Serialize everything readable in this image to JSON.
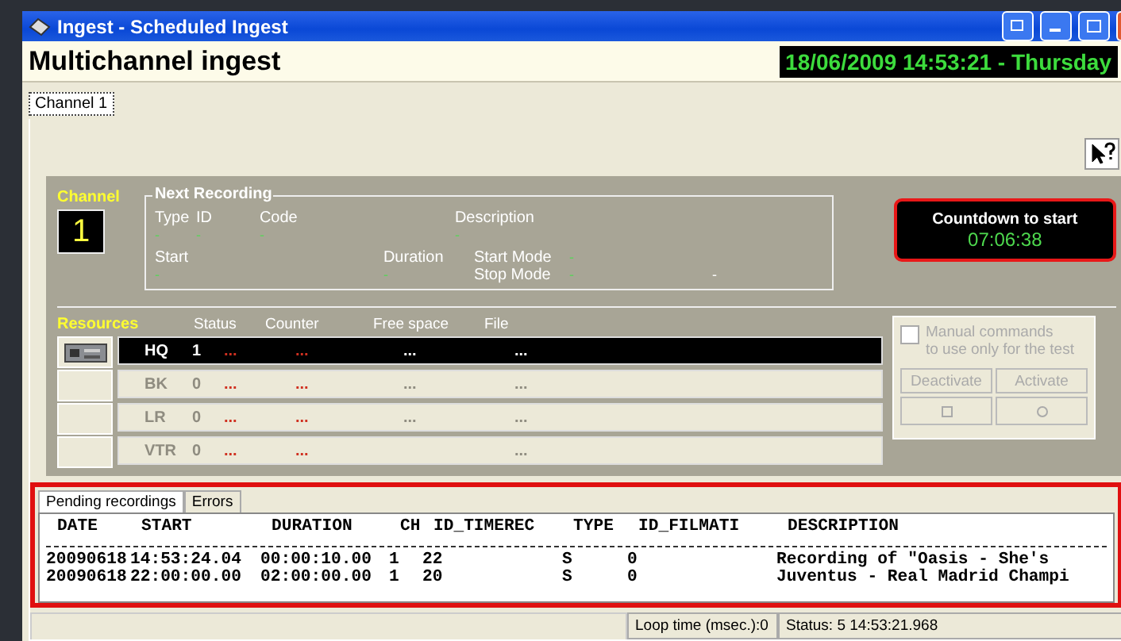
{
  "window": {
    "title": "Ingest - Scheduled Ingest"
  },
  "header": {
    "title": "Multichannel ingest",
    "clock": "18/06/2009 14:53:21 - Thursday"
  },
  "tabs": [
    {
      "label": "Channel 1",
      "selected": true
    }
  ],
  "channel": {
    "label": "Channel",
    "number": "1"
  },
  "next_recording": {
    "title": "Next Recording",
    "fields": [
      {
        "label": "Type",
        "value": "-"
      },
      {
        "label": "ID",
        "value": "-"
      },
      {
        "label": "Code",
        "value": "-"
      },
      {
        "label": "Description",
        "value": "-"
      },
      {
        "label": "Start",
        "value": "-"
      },
      {
        "label": "Duration",
        "value": "-"
      }
    ],
    "modes": [
      {
        "label": "Start Mode",
        "value": "-"
      },
      {
        "label": "Stop Mode",
        "value": "-",
        "extra": "-"
      }
    ]
  },
  "countdown": {
    "title": "Countdown to start",
    "value": "07:06:38"
  },
  "resources": {
    "title": "Resources",
    "columns": [
      "Status",
      "Counter",
      "Free space",
      "File"
    ],
    "rows": [
      {
        "name": "HQ",
        "count": "1",
        "active": true,
        "device": true,
        "status": "...",
        "counter": "...",
        "free_space": "...",
        "file": "..."
      },
      {
        "name": "BK",
        "count": "0",
        "active": false,
        "device": false,
        "status": "...",
        "counter": "...",
        "free_space": "...",
        "file": "..."
      },
      {
        "name": "LR",
        "count": "0",
        "active": false,
        "device": false,
        "status": "...",
        "counter": "...",
        "free_space": "...",
        "file": "..."
      },
      {
        "name": "VTR",
        "count": "0",
        "active": false,
        "device": false,
        "status": "...",
        "counter": "...",
        "free_space": "",
        "file": "..."
      }
    ]
  },
  "manual": {
    "label": "Manual commands",
    "sublabel": "to use only for the test",
    "checked": false,
    "disabled": true,
    "buttons": [
      "Deactivate",
      "Activate"
    ]
  },
  "bottom_tabs": [
    {
      "label": "Pending recordings",
      "selected": true
    },
    {
      "label": "Errors",
      "selected": false
    }
  ],
  "pending": {
    "columns": [
      "DATE",
      "START",
      "DURATION",
      "CH",
      "ID_TIMEREC",
      "TYPE",
      "ID_FILMATI",
      "DESCRIPTION"
    ],
    "rows": [
      [
        "20090618",
        "14:53:24.04",
        "00:00:10.00",
        "1",
        "22",
        "S",
        "0",
        "Recording of \"Oasis - She's"
      ],
      [
        "20090618",
        "22:00:00.00",
        "02:00:00.00",
        "1",
        "20",
        "S",
        "0",
        "Juventus - Real Madrid Champi"
      ]
    ]
  },
  "status_bar": {
    "loop_time": "Loop time (msec.):0",
    "status": "Status: 5  14:53:21.968"
  }
}
